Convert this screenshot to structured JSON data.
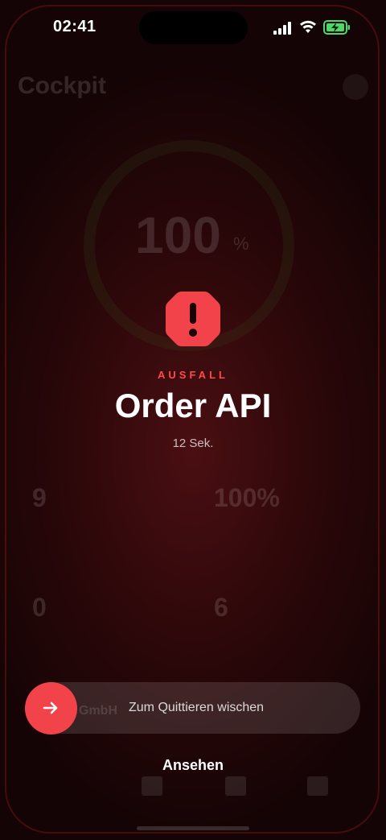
{
  "status_bar": {
    "time": "02:41"
  },
  "background": {
    "title": "Cockpit",
    "uptime_value": "100",
    "uptime_unit": "%",
    "cards": [
      {
        "value": "9"
      },
      {
        "value": "100%"
      },
      {
        "value": "0"
      },
      {
        "value": "6"
      }
    ],
    "company": "GmbH"
  },
  "alert": {
    "kind": "AUSFALL",
    "title": "Order API",
    "duration": "12 Sek."
  },
  "actions": {
    "swipe_label": "Zum Quittieren wischen",
    "view_label": "Ansehen"
  },
  "colors": {
    "accent_red": "#f2434a",
    "alert_label": "#ff4a4a",
    "battery_green": "#4cd964"
  }
}
